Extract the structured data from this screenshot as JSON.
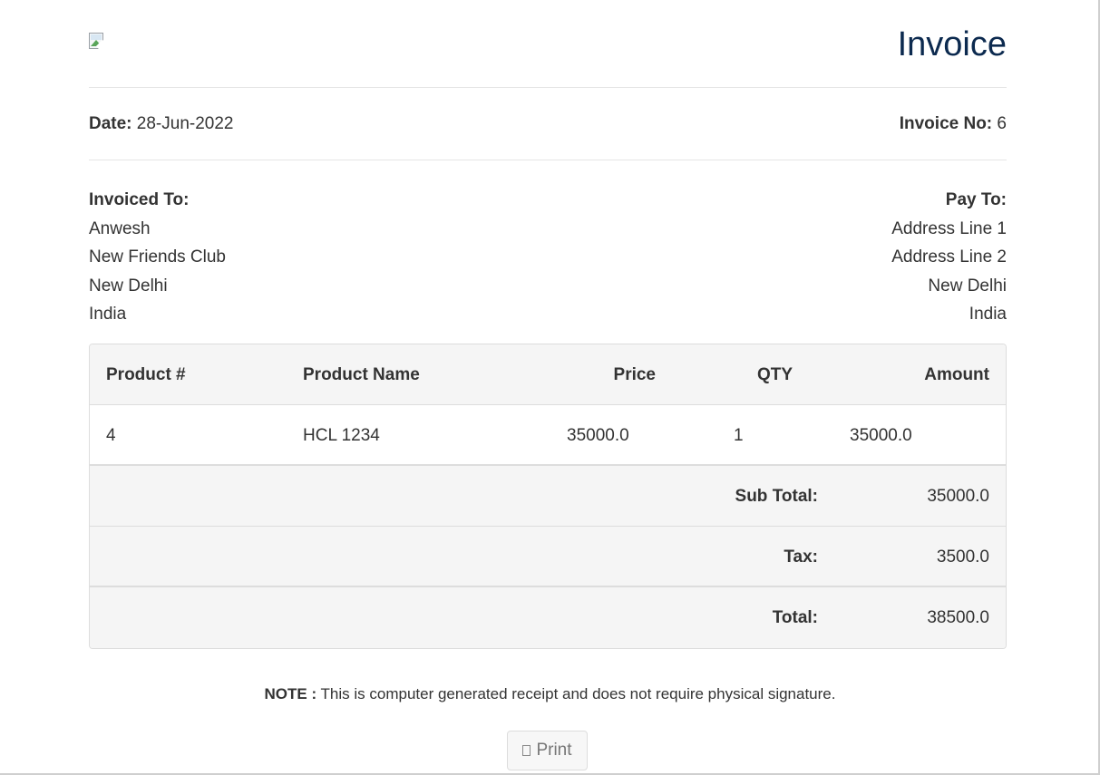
{
  "header": {
    "title": "Invoice",
    "logo_icon": "broken-image-icon"
  },
  "meta": {
    "date_label": "Date:",
    "date_value": "28-Jun-2022",
    "invoice_no_label": "Invoice No:",
    "invoice_no_value": "6"
  },
  "invoiced_to": {
    "label": "Invoiced To:",
    "lines": [
      "Anwesh",
      "New Friends Club",
      "New Delhi",
      "India"
    ]
  },
  "pay_to": {
    "label": "Pay To:",
    "lines": [
      "Address Line 1",
      "Address Line 2",
      "New Delhi",
      "India"
    ]
  },
  "table": {
    "headers": {
      "product_no": "Product #",
      "product_name": "Product Name",
      "price": "Price",
      "qty": "QTY",
      "amount": "Amount"
    },
    "rows": [
      {
        "product_no": "4",
        "product_name": "HCL 1234",
        "price": "35000.0",
        "qty": "1",
        "amount": "35000.0"
      }
    ],
    "summary": {
      "subtotal_label": "Sub Total:",
      "subtotal_value": "35000.0",
      "tax_label": "Tax:",
      "tax_value": "3500.0",
      "total_label": "Total:",
      "total_value": "38500.0"
    }
  },
  "note": {
    "label": "NOTE :",
    "text": "This is computer generated receipt and does not require physical signature."
  },
  "print_button": {
    "label": "Print",
    "icon": "print-icon"
  },
  "colors": {
    "title": "#0c2a4f",
    "text": "#333333",
    "table_header_bg": "#f5f5f5",
    "border": "#dddddd"
  }
}
